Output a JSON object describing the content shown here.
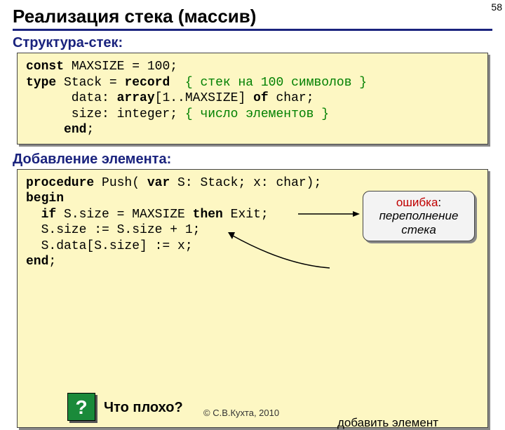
{
  "page_number": "58",
  "title": "Реализация стека (массив)",
  "sections": {
    "struct_heading": "Структура-стек:",
    "add_heading": "Добавление элемента:"
  },
  "code1": {
    "l1a": "const",
    "l1b": " MAXSIZE = 100;",
    "l2a": "type",
    "l2b": " Stack = ",
    "l2c": "record",
    "l2d": "  ",
    "l2e": "{ стек на 100 символов }",
    "l3a": "      data: ",
    "l3b": "array",
    "l3c": "[1..MAXSIZE] ",
    "l3d": "of",
    "l3e": " char;",
    "l4a": "      size: integer; ",
    "l4b": "{ число элементов }",
    "l5a": "     ",
    "l5b": "end",
    "l5c": ";"
  },
  "code2": {
    "l1a": "procedure",
    "l1b": " Push( ",
    "l1c": "var",
    "l1d": " S: Stack; x: char);",
    "l2a": "begin",
    "l3a": "  ",
    "l3b": "if",
    "l3c": " S.size = MAXSIZE ",
    "l3d": "then",
    "l3e": " Exit;",
    "l4a": "  S.size := S.size + 1;",
    "l5a": "  S.data[S.size] := x;",
    "l6a": "end",
    "l6b": ";"
  },
  "callout": {
    "error_label": "ошибка",
    "error_text": "переполнение стека"
  },
  "annotation": {
    "add_elem": "добавить элемент"
  },
  "question": {
    "mark": "?",
    "text": "Что плохо?"
  },
  "copyright": "© С.В.Кухта, 2010"
}
